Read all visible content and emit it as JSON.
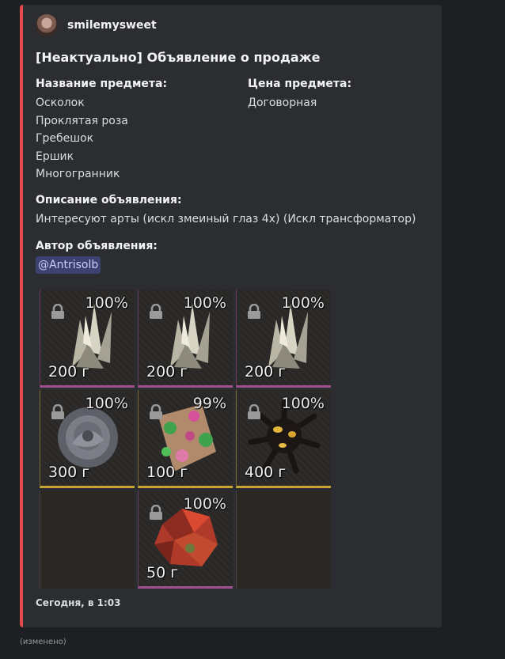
{
  "author": {
    "name": "smilemysweet"
  },
  "title": "[Неактуально] Объявление о продаже",
  "fields": {
    "item_name_label": "Название предмета:",
    "items": [
      "Осколок",
      "Проклятая роза",
      "Гребешок",
      "Ершик",
      "Многогранник"
    ],
    "price_label": "Цена предмета:",
    "price_value": "Договорная",
    "description_label": "Описание объявления:",
    "description_value": "Интересуют арты (искл змеиный глаз 4х) (Искл трансформатор)",
    "author_label": "Автор объявления:",
    "author_mention": "@Antrisolb"
  },
  "inventory": {
    "cells": [
      {
        "percent": "100%",
        "price": "200 г",
        "icon": "crystal-shard",
        "rarity": "purple"
      },
      {
        "percent": "100%",
        "price": "200 г",
        "icon": "crystal-shard",
        "rarity": "purple"
      },
      {
        "percent": "100%",
        "price": "200 г",
        "icon": "crystal-shard",
        "rarity": "purple"
      },
      {
        "percent": "100%",
        "price": "300 г",
        "icon": "cursed-rose",
        "rarity": "gold"
      },
      {
        "percent": "99%",
        "price": "100 г",
        "icon": "comb-artifact",
        "rarity": "gold"
      },
      {
        "percent": "100%",
        "price": "400 г",
        "icon": "spiky-urchin",
        "rarity": "gold"
      },
      {
        "percent": "",
        "price": "",
        "icon": "",
        "rarity": "empty"
      },
      {
        "percent": "100%",
        "price": "50 г",
        "icon": "red-polyhedron",
        "rarity": "purple"
      },
      {
        "percent": "",
        "price": "",
        "icon": "",
        "rarity": "empty"
      }
    ]
  },
  "footer": {
    "timestamp": "Сегодня, в 1:03"
  },
  "edited_label": "(изменено)",
  "colors": {
    "embed_accent": "#e54b4b",
    "mention_bg": "#3c4270",
    "rarity_purple": "#a0508f",
    "rarity_gold": "#c7a533"
  }
}
